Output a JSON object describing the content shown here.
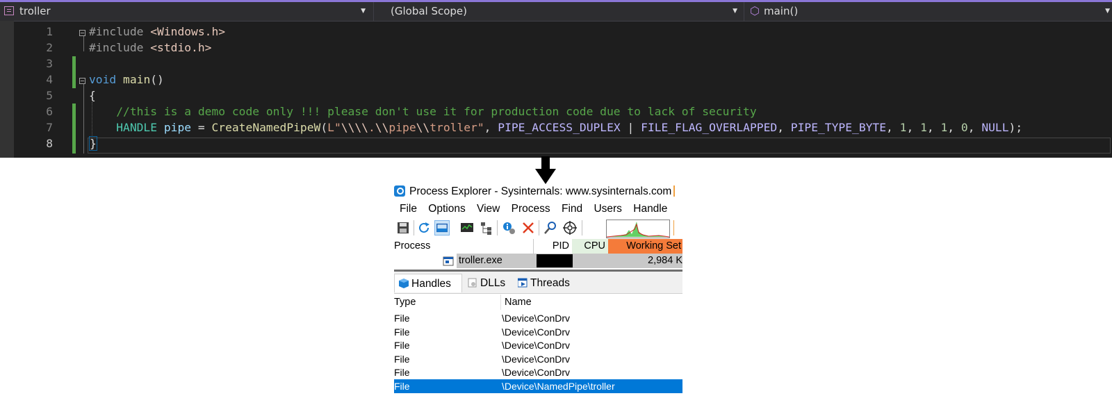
{
  "editor": {
    "nav": {
      "project": "troller",
      "scope": "(Global Scope)",
      "member": "main()"
    },
    "lines": [
      {
        "num": "1",
        "tokens": [
          [
            "c-pp",
            "#include "
          ],
          [
            "c-inc",
            "<Windows.h>"
          ]
        ]
      },
      {
        "num": "2",
        "tokens": [
          [
            "c-pp",
            "#include "
          ],
          [
            "c-inc",
            "<stdio.h>"
          ]
        ]
      },
      {
        "num": "3",
        "tokens": []
      },
      {
        "num": "4",
        "tokens": [
          [
            "c-kw",
            "void"
          ],
          [
            "c-pn",
            " "
          ],
          [
            "c-fn",
            "main"
          ],
          [
            "c-pn",
            "()"
          ]
        ]
      },
      {
        "num": "5",
        "tokens": [
          [
            "c-pn",
            "{"
          ]
        ]
      },
      {
        "num": "6",
        "tokens": [
          [
            "c-pn",
            "    "
          ],
          [
            "c-cm",
            "//this is a demo code only !!! please don't use it for production code due to lack of security"
          ]
        ]
      },
      {
        "num": "7",
        "tokens": [
          [
            "c-pn",
            "    "
          ],
          [
            "c-ty",
            "HANDLE"
          ],
          [
            "c-pn",
            " "
          ],
          [
            "c-var",
            "pipe"
          ],
          [
            "c-pn",
            " = "
          ],
          [
            "c-fn",
            "CreateNamedPipeW"
          ],
          [
            "c-pn",
            "("
          ],
          [
            "c-str",
            "L\""
          ],
          [
            "c-esc",
            "\\\\\\\\"
          ],
          [
            "c-str",
            "."
          ],
          [
            "c-esc",
            "\\\\"
          ],
          [
            "c-str",
            "pipe"
          ],
          [
            "c-esc",
            "\\\\"
          ],
          [
            "c-str",
            "troller\""
          ],
          [
            "c-pn",
            ", "
          ],
          [
            "c-mac",
            "PIPE_ACCESS_DUPLEX"
          ],
          [
            "c-pn",
            " | "
          ],
          [
            "c-mac",
            "FILE_FLAG_OVERLAPPED"
          ],
          [
            "c-pn",
            ", "
          ],
          [
            "c-mac",
            "PIPE_TYPE_BYTE"
          ],
          [
            "c-pn",
            ", "
          ],
          [
            "c-num",
            "1"
          ],
          [
            "c-pn",
            ", "
          ],
          [
            "c-num",
            "1"
          ],
          [
            "c-pn",
            ", "
          ],
          [
            "c-num",
            "1"
          ],
          [
            "c-pn",
            ", "
          ],
          [
            "c-num",
            "0"
          ],
          [
            "c-pn",
            ", "
          ],
          [
            "c-mac",
            "NULL"
          ],
          [
            "c-pn",
            ");"
          ]
        ]
      },
      {
        "num": "8",
        "tokens": [
          [
            "c-br",
            "}"
          ]
        ]
      }
    ]
  },
  "procexp": {
    "title": "Process Explorer - Sysinternals: www.sysinternals.com",
    "menu": [
      "File",
      "Options",
      "View",
      "Process",
      "Find",
      "Users",
      "Handle"
    ],
    "columns": {
      "process": "Process",
      "pid": "PID",
      "cpu": "CPU",
      "working_set": "Working Set"
    },
    "process_row": {
      "name": "troller.exe",
      "working_set": "2,984 K"
    },
    "tabs": [
      "Handles",
      "DLLs",
      "Threads"
    ],
    "handles_header": {
      "type": "Type",
      "name": "Name"
    },
    "handles": [
      {
        "type": "File",
        "name": "\\Device\\ConDrv"
      },
      {
        "type": "File",
        "name": "\\Device\\ConDrv"
      },
      {
        "type": "File",
        "name": "\\Device\\ConDrv"
      },
      {
        "type": "File",
        "name": "\\Device\\ConDrv"
      },
      {
        "type": "File",
        "name": "\\Device\\ConDrv"
      },
      {
        "type": "File",
        "name": "\\Device\\NamedPipe\\troller",
        "selected": true
      }
    ],
    "colors": {
      "working_set_header": "#f47b3a",
      "cpu_header": "#e2f1e0",
      "selection": "#0078d7"
    }
  }
}
